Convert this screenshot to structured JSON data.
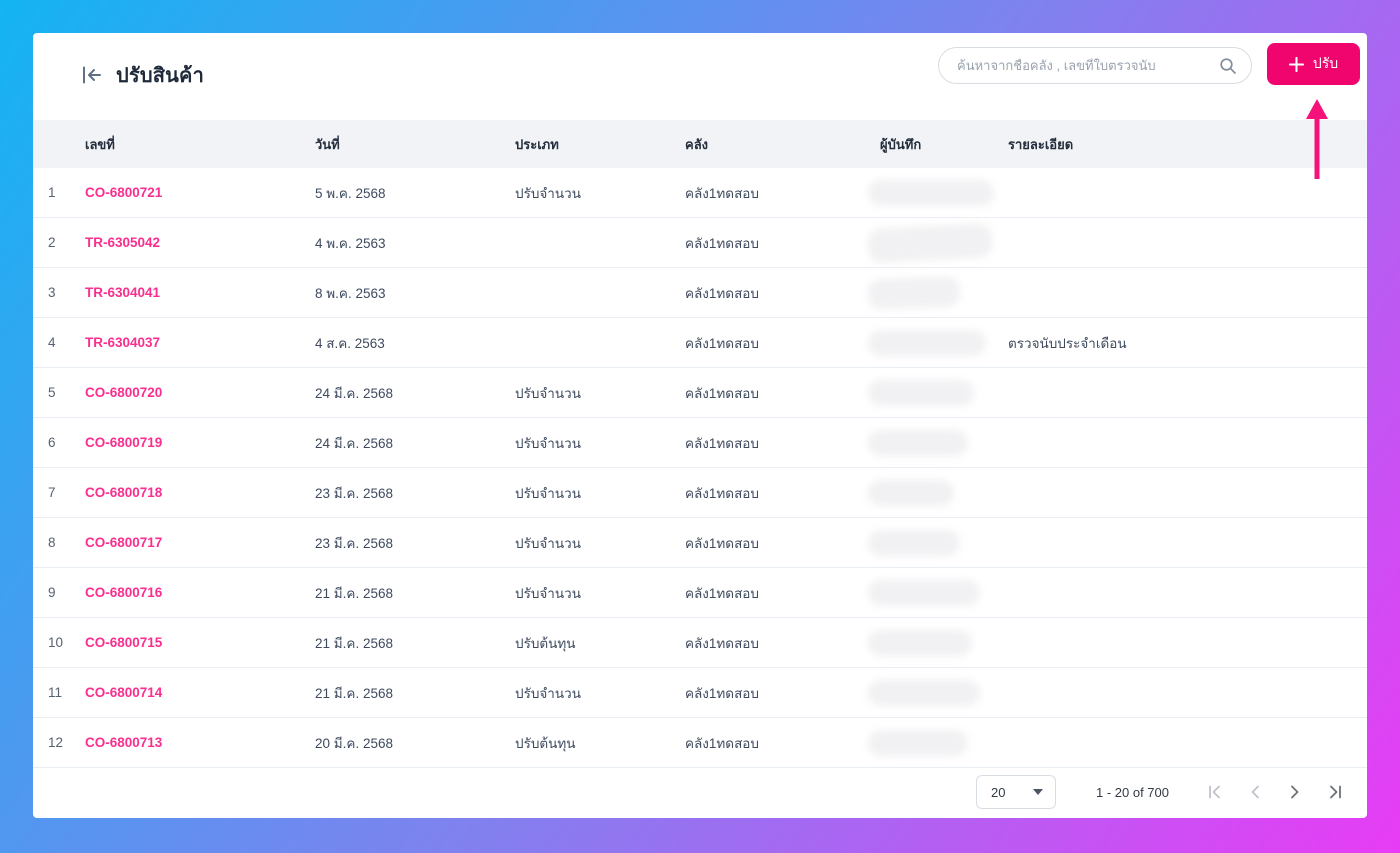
{
  "page": {
    "title": "ปรับสินค้า"
  },
  "search": {
    "placeholder": "ค้นหาจากชื่อคลัง , เลขที่ใบตรวจนับ"
  },
  "add_button": {
    "label": "ปรับ"
  },
  "table": {
    "columns": {
      "no": "เลขที่",
      "date": "วันที่",
      "type": "ประเภท",
      "warehouse": "คลัง",
      "recorder": "ผู้บันทึก",
      "details": "รายละเอียด"
    },
    "rows": [
      {
        "index": "1",
        "no": "CO-6800721",
        "date": "5 พ.ค. 2568",
        "type": "ปรับจำนวน",
        "warehouse": "คลัง1ทดสอบ",
        "recorder_blurred": true,
        "details": ""
      },
      {
        "index": "2",
        "no": "TR-6305042",
        "date": "4 พ.ค. 2563",
        "type": "",
        "warehouse": "คลัง1ทดสอบ",
        "recorder_blurred": true,
        "details": ""
      },
      {
        "index": "3",
        "no": "TR-6304041",
        "date": "8 พ.ค. 2563",
        "type": "",
        "warehouse": "คลัง1ทดสอบ",
        "recorder_blurred": true,
        "details": ""
      },
      {
        "index": "4",
        "no": "TR-6304037",
        "date": "4 ส.ค. 2563",
        "type": "",
        "warehouse": "คลัง1ทดสอบ",
        "recorder_blurred": true,
        "details": "ตรวจนับประจำเดือน"
      },
      {
        "index": "5",
        "no": "CO-6800720",
        "date": "24 มี.ค. 2568",
        "type": "ปรับจำนวน",
        "warehouse": "คลัง1ทดสอบ",
        "recorder_blurred": true,
        "details": ""
      },
      {
        "index": "6",
        "no": "CO-6800719",
        "date": "24 มี.ค. 2568",
        "type": "ปรับจำนวน",
        "warehouse": "คลัง1ทดสอบ",
        "recorder_blurred": true,
        "details": ""
      },
      {
        "index": "7",
        "no": "CO-6800718",
        "date": "23 มี.ค. 2568",
        "type": "ปรับจำนวน",
        "warehouse": "คลัง1ทดสอบ",
        "recorder_blurred": true,
        "details": ""
      },
      {
        "index": "8",
        "no": "CO-6800717",
        "date": "23 มี.ค. 2568",
        "type": "ปรับจำนวน",
        "warehouse": "คลัง1ทดสอบ",
        "recorder_blurred": true,
        "details": ""
      },
      {
        "index": "9",
        "no": "CO-6800716",
        "date": "21 มี.ค. 2568",
        "type": "ปรับจำนวน",
        "warehouse": "คลัง1ทดสอบ",
        "recorder_blurred": true,
        "details": ""
      },
      {
        "index": "10",
        "no": "CO-6800715",
        "date": "21 มี.ค. 2568",
        "type": "ปรับต้นทุน",
        "warehouse": "คลัง1ทดสอบ",
        "recorder_blurred": true,
        "details": ""
      },
      {
        "index": "11",
        "no": "CO-6800714",
        "date": "21 มี.ค. 2568",
        "type": "ปรับจำนวน",
        "warehouse": "คลัง1ทดสอบ",
        "recorder_blurred": true,
        "details": ""
      },
      {
        "index": "12",
        "no": "CO-6800713",
        "date": "20 มี.ค. 2568",
        "type": "ปรับต้นทุน",
        "warehouse": "คลัง1ทดสอบ",
        "recorder_blurred": true,
        "details": ""
      }
    ]
  },
  "pagination": {
    "page_size": "20",
    "range_label": "1 - 20 of 700"
  },
  "icons": {
    "collapse": "collapse-sidebar-icon",
    "search": "search-icon",
    "plus": "plus-icon",
    "annotation": "annotation-arrow-up"
  },
  "colors": {
    "button_pink": "#f0056f",
    "link_pink": "#fa2e8e",
    "arrow_pink": "#f5137b",
    "gradient_start": "#14b4f2",
    "gradient_end": "#e83cf5",
    "header_bg": "#f1f3f6"
  }
}
